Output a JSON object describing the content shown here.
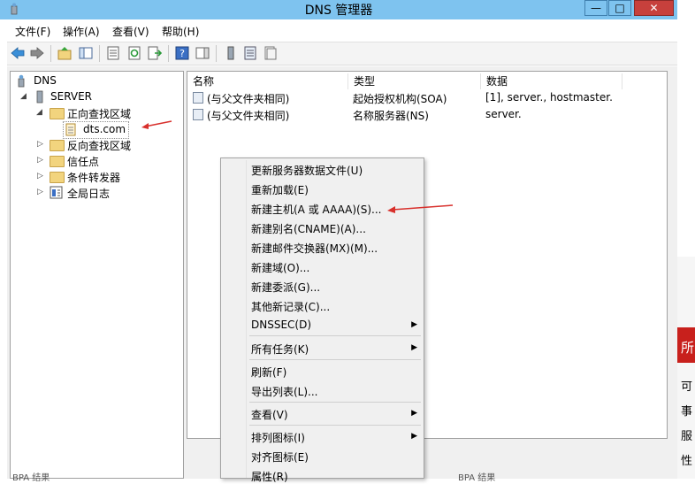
{
  "window": {
    "title": "DNS 管理器",
    "min_label": "—",
    "max_label": "□",
    "close_label": "✕"
  },
  "menubar": {
    "items": [
      "文件(F)",
      "操作(A)",
      "查看(V)",
      "帮助(H)"
    ]
  },
  "tree": {
    "root": "DNS",
    "server": "SERVER",
    "forward_zone": "正向查找区域",
    "zone_selected": "dts.com",
    "reverse_zone": "反向查找区域",
    "trust_points": "信任点",
    "conditional_forwarders": "条件转发器",
    "global_logs": "全局日志"
  },
  "list": {
    "columns": [
      "名称",
      "类型",
      "数据"
    ],
    "rows": [
      {
        "name": "(与父文件夹相同)",
        "type": "起始授权机构(SOA)",
        "data": "[1], server., hostmaster."
      },
      {
        "name": "(与父文件夹相同)",
        "type": "名称服务器(NS)",
        "data": "server."
      }
    ]
  },
  "context_menu": {
    "items": [
      "更新服务器数据文件(U)",
      "重新加载(E)",
      "新建主机(A 或 AAAA)(S)...",
      "新建别名(CNAME)(A)...",
      "新建邮件交换器(MX)(M)...",
      "新建域(O)...",
      "新建委派(G)...",
      "其他新记录(C)...",
      "DNSSEC(D)",
      "所有任务(K)",
      "刷新(F)",
      "导出列表(L)...",
      "查看(V)",
      "排列图标(I)",
      "对齐图标(E)",
      "属性(R)"
    ]
  },
  "right_strip": {
    "header": "所",
    "items": [
      "可",
      "事",
      "服",
      "性"
    ]
  },
  "status": {
    "left": "BPA 结果",
    "right": "BPA 结果"
  },
  "colors": {
    "titlebar": "#7ec3ef",
    "close": "#c7403c",
    "accent_red": "#c8201c"
  }
}
